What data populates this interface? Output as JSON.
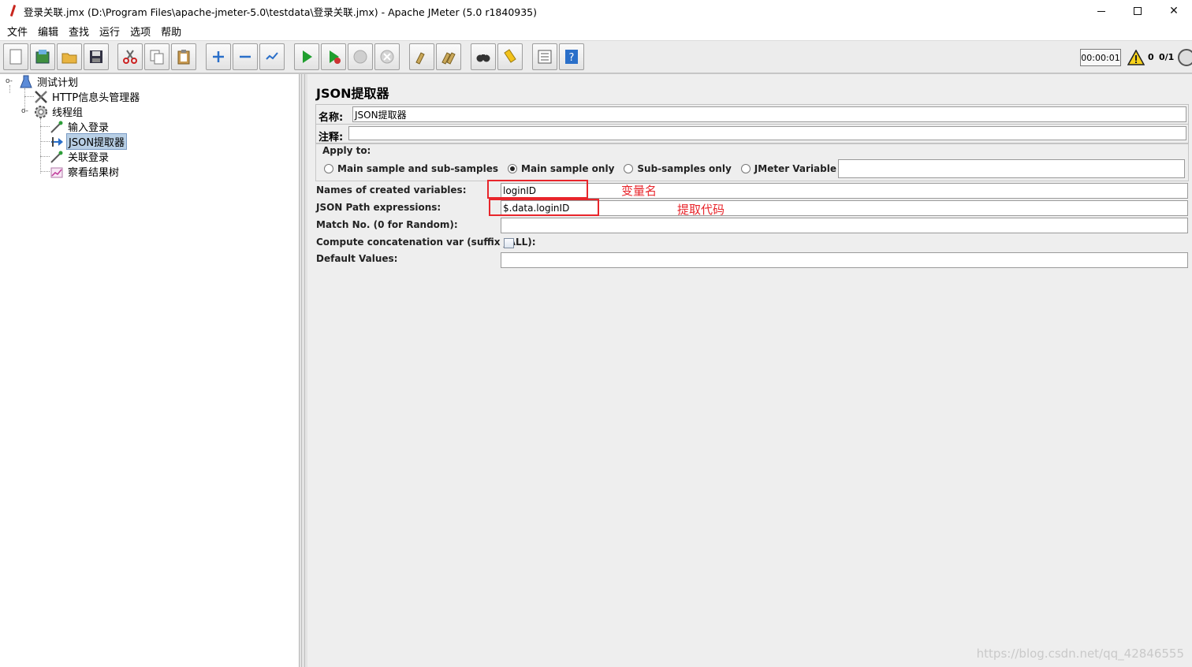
{
  "window": {
    "title": "登录关联.jmx (D:\\Program Files\\apache-jmeter-5.0\\testdata\\登录关联.jmx) - Apache JMeter (5.0 r1840935)",
    "close_glyph": "✕"
  },
  "menu": [
    "文件",
    "编辑",
    "查找",
    "运行",
    "选项",
    "帮助"
  ],
  "toolbar": {
    "timer": "00:00:01",
    "error_count": "0",
    "thread_count": "0/1",
    "icons": [
      "new-icon",
      "templates-icon",
      "open-icon",
      "save-icon",
      "cut-icon",
      "copy-icon",
      "paste-icon",
      "expand-icon",
      "collapse-icon",
      "toggle-icon",
      "start-icon",
      "start-no-pause-icon",
      "stop-icon",
      "shutdown-icon",
      "clear-icon",
      "clear-all-icon",
      "search-icon",
      "reset-search-icon",
      "function-helper-icon",
      "help-icon"
    ]
  },
  "tree": {
    "items": [
      {
        "label": "测试计划",
        "icon": "test-plan-icon"
      },
      {
        "label": "HTTP信息头管理器",
        "icon": "config-tools-icon"
      },
      {
        "label": "线程组",
        "icon": "thread-group-gear-icon"
      },
      {
        "label": "输入登录",
        "icon": "sampler-pipette-icon"
      },
      {
        "label": "JSON提取器",
        "icon": "post-processor-icon",
        "selected": true
      },
      {
        "label": "关联登录",
        "icon": "sampler-pipette-icon"
      },
      {
        "label": "察看结果树",
        "icon": "listener-chart-icon"
      }
    ]
  },
  "panel": {
    "title": "JSON提取器",
    "name_label": "名称:",
    "name_value": "JSON提取器",
    "comment_label": "注释:",
    "comment_value": "",
    "apply_to": {
      "legend": "Apply to:",
      "options": [
        {
          "label": "Main sample and sub-samples",
          "selected": false
        },
        {
          "label": "Main sample only",
          "selected": true
        },
        {
          "label": "Sub-samples only",
          "selected": false
        },
        {
          "label": "JMeter Variable Name to use",
          "selected": false
        }
      ],
      "variable_name_value": ""
    },
    "fields": [
      {
        "label": "Names of created variables:",
        "value": "loginID"
      },
      {
        "label": "JSON Path expressions:",
        "value": "$.data.loginID"
      },
      {
        "label": "Match No. (0 for Random):",
        "value": ""
      },
      {
        "label": "Compute concatenation var (suffix _ALL):",
        "checked": false
      },
      {
        "label": "Default Values:",
        "value": ""
      }
    ]
  },
  "annotations": {
    "variable_note": "变量名",
    "path_note": "提取代码",
    "color": "#e8252b"
  },
  "watermark": "https://blog.csdn.net/qq_42846555"
}
